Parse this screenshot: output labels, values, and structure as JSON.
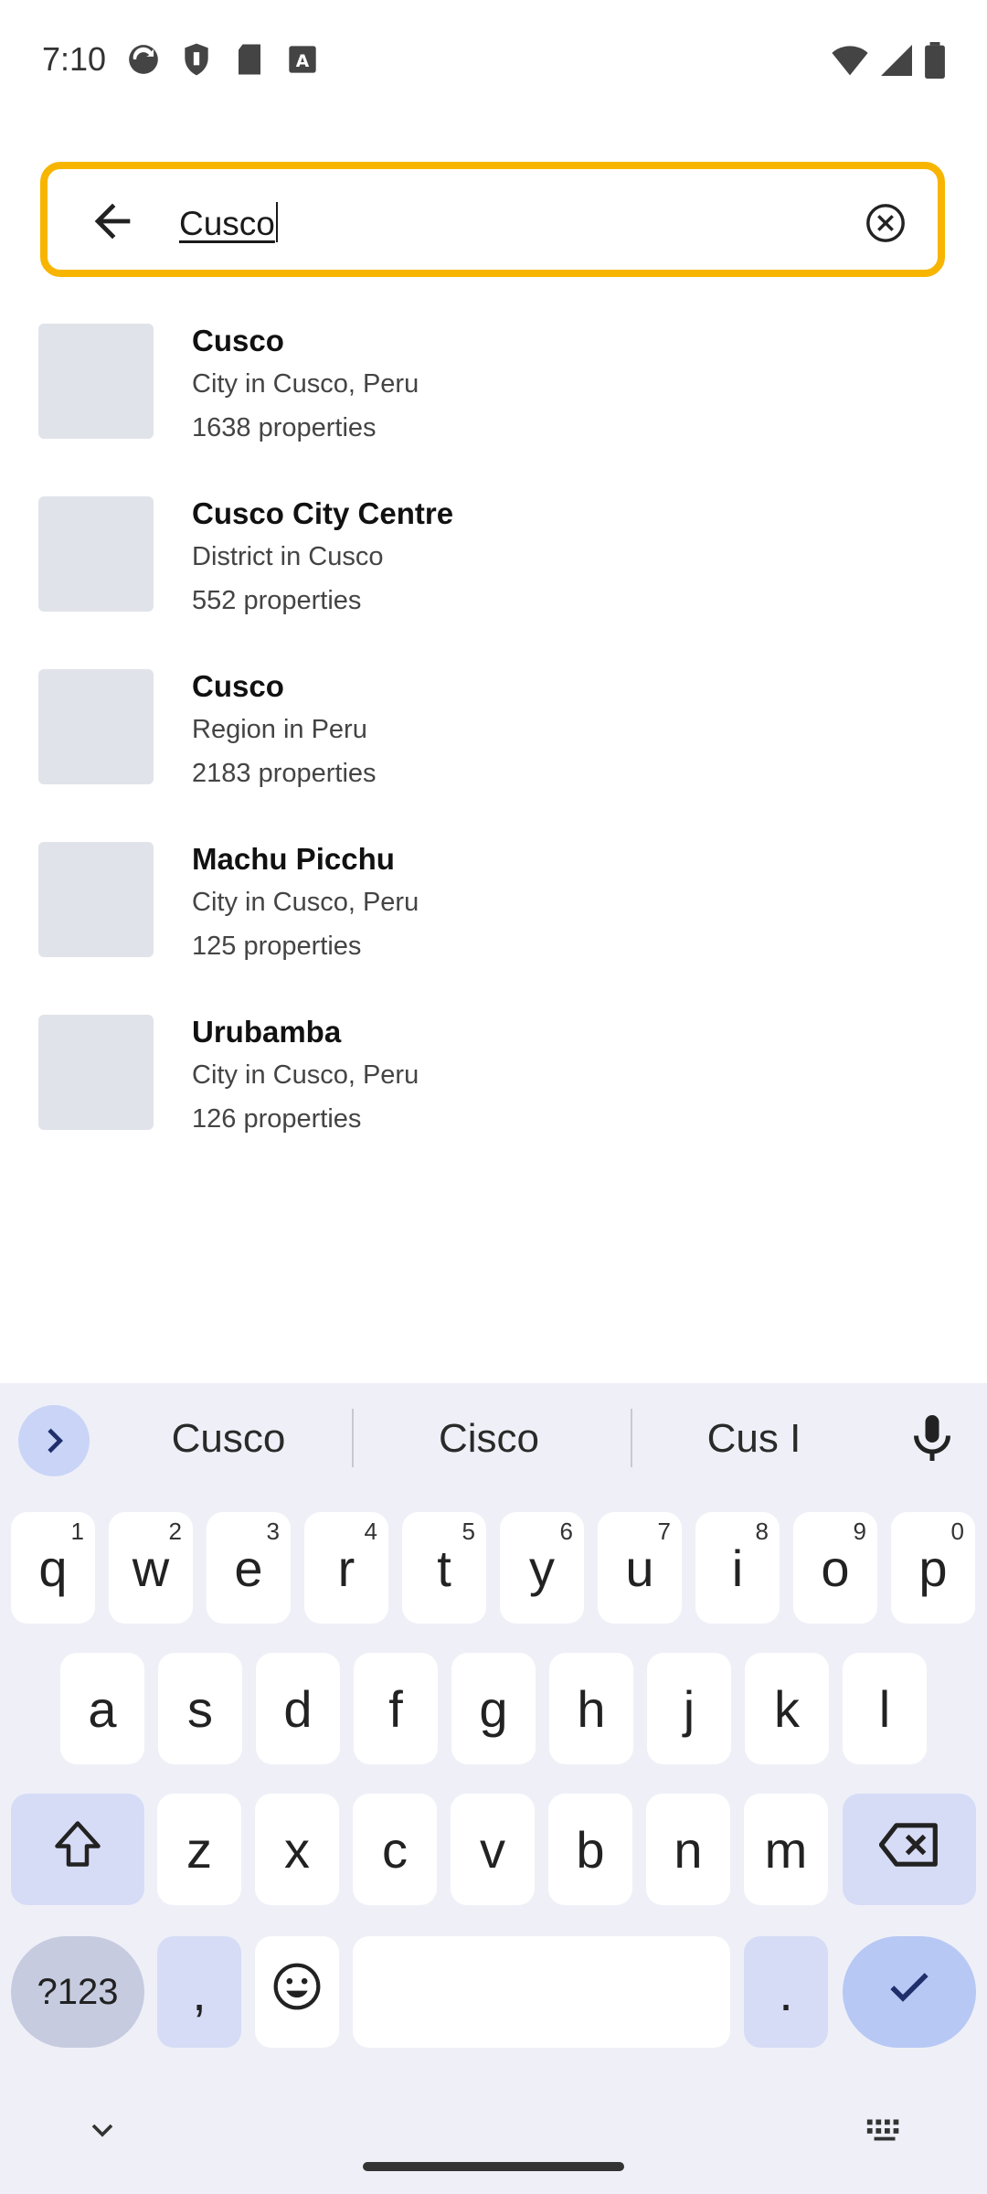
{
  "status": {
    "time": "7:10"
  },
  "search": {
    "value": "Cusco"
  },
  "results": [
    {
      "name": "Cusco",
      "subtitle": "City in Cusco, Peru",
      "count": "1638 properties"
    },
    {
      "name": "Cusco City Centre",
      "subtitle": "District in Cusco",
      "count": "552 properties"
    },
    {
      "name": "Cusco",
      "subtitle": "Region in Peru",
      "count": "2183 properties"
    },
    {
      "name": "Machu Picchu",
      "subtitle": "City in Cusco, Peru",
      "count": "125 properties"
    },
    {
      "name": "Urubamba",
      "subtitle": "City in Cusco, Peru",
      "count": "126 properties"
    }
  ],
  "keyboard": {
    "suggestions": [
      "Cusco",
      "Cisco",
      "Cus I"
    ],
    "row1": [
      {
        "k": "q",
        "h": "1"
      },
      {
        "k": "w",
        "h": "2"
      },
      {
        "k": "e",
        "h": "3"
      },
      {
        "k": "r",
        "h": "4"
      },
      {
        "k": "t",
        "h": "5"
      },
      {
        "k": "y",
        "h": "6"
      },
      {
        "k": "u",
        "h": "7"
      },
      {
        "k": "i",
        "h": "8"
      },
      {
        "k": "o",
        "h": "9"
      },
      {
        "k": "p",
        "h": "0"
      }
    ],
    "row2": [
      "a",
      "s",
      "d",
      "f",
      "g",
      "h",
      "j",
      "k",
      "l"
    ],
    "row3": [
      "z",
      "x",
      "c",
      "v",
      "b",
      "n",
      "m"
    ],
    "symbols_label": "?123",
    "comma": ",",
    "period": "."
  },
  "colors": {
    "accent": "#f7b500",
    "thumb": "#e1e3ea",
    "keyboard_bg": "#eff0f7"
  },
  "icons": [
    "back-arrow-icon",
    "clear-icon",
    "chevron-right-icon",
    "mic-icon",
    "shift-icon",
    "backspace-icon",
    "emoji-icon",
    "check-icon",
    "chevron-down-icon",
    "keyboard-icon"
  ]
}
